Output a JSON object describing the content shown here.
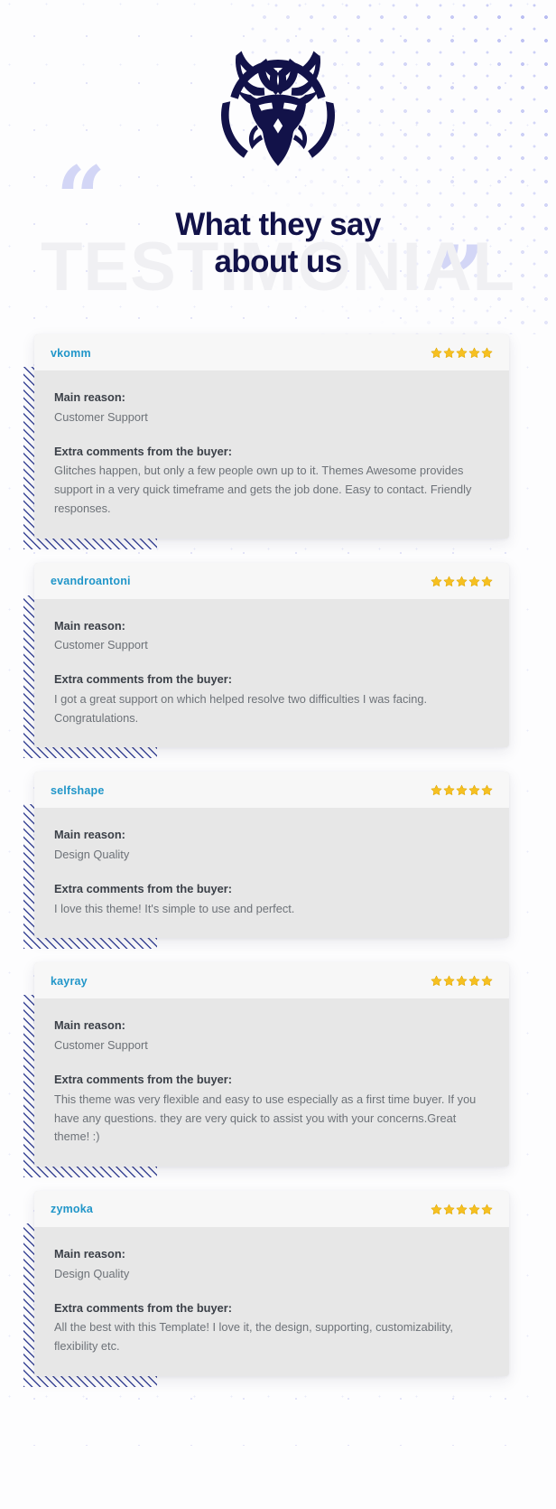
{
  "header": {
    "logo_icon": "deer-head-logo-icon",
    "quote_open": "“",
    "quote_close": "”",
    "watermark": "TESTIMONIAL",
    "title_line1": "What they say",
    "title_line2": "about us"
  },
  "labels": {
    "main_reason": "Main reason:",
    "extra_comments": "Extra comments from the buyer:",
    "star_icon": "star-icon"
  },
  "colors": {
    "navy": "#121249",
    "username_blue": "#2196c9",
    "star_gold": "#f6c021",
    "hatch_indigo": "#3c4898",
    "periwinkle": "#d3d6f6",
    "dot_purple": "#b9bdf2",
    "card_body_bg": "#e7e7e7",
    "card_head_bg": "#f7f7f7",
    "watermark_gray": "#f0f0f3"
  },
  "testimonials": [
    {
      "username": "vkomm",
      "rating": 5,
      "main_reason": "Customer Support",
      "comment": "Glitches happen, but only a few people own up to it. Themes Awesome provides support in a very quick timeframe and gets the job done. Easy to contact. Friendly responses."
    },
    {
      "username": "evandroantoni",
      "rating": 5,
      "main_reason": "Customer Support",
      "comment": "I got a great support on which helped resolve two difficulties I was facing. Congratulations."
    },
    {
      "username": "selfshape",
      "rating": 5,
      "main_reason": "Design Quality",
      "comment": "I love this theme! It's simple to use and perfect."
    },
    {
      "username": "kayray",
      "rating": 5,
      "main_reason": "Customer Support",
      "comment": "This theme was very flexible and easy to use especially as a first time buyer. If you have any questions. they are very quick to assist you with your concerns.Great theme! :)"
    },
    {
      "username": "zymoka",
      "rating": 5,
      "main_reason": "Design Quality",
      "comment": "All the best with this Template! I love it, the design, supporting, customizability, flexibility etc."
    }
  ]
}
